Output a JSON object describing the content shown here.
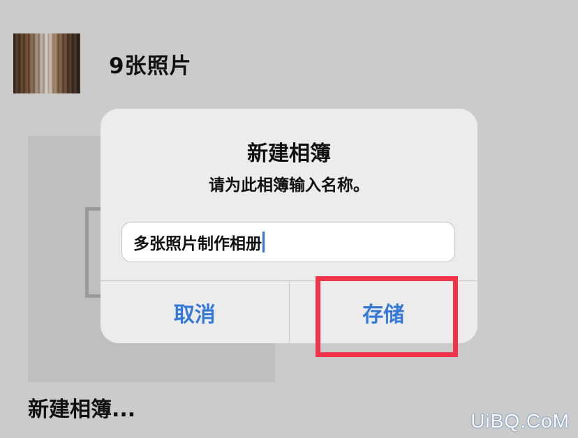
{
  "album": {
    "count_label": "9张照片"
  },
  "tile": {
    "caption": "新建相簿..."
  },
  "dialog": {
    "title": "新建相簿",
    "message": "请为此相簿输入名称。",
    "input_value": "多张照片制作相册",
    "cancel_label": "取消",
    "save_label": "存储"
  },
  "annotation": {
    "color": "#f0344a"
  },
  "colors": {
    "accent": "#3478d8",
    "background": "#cbcbcb",
    "dialog_bg": "#ececec"
  },
  "watermark": "UiBQ.CoM"
}
